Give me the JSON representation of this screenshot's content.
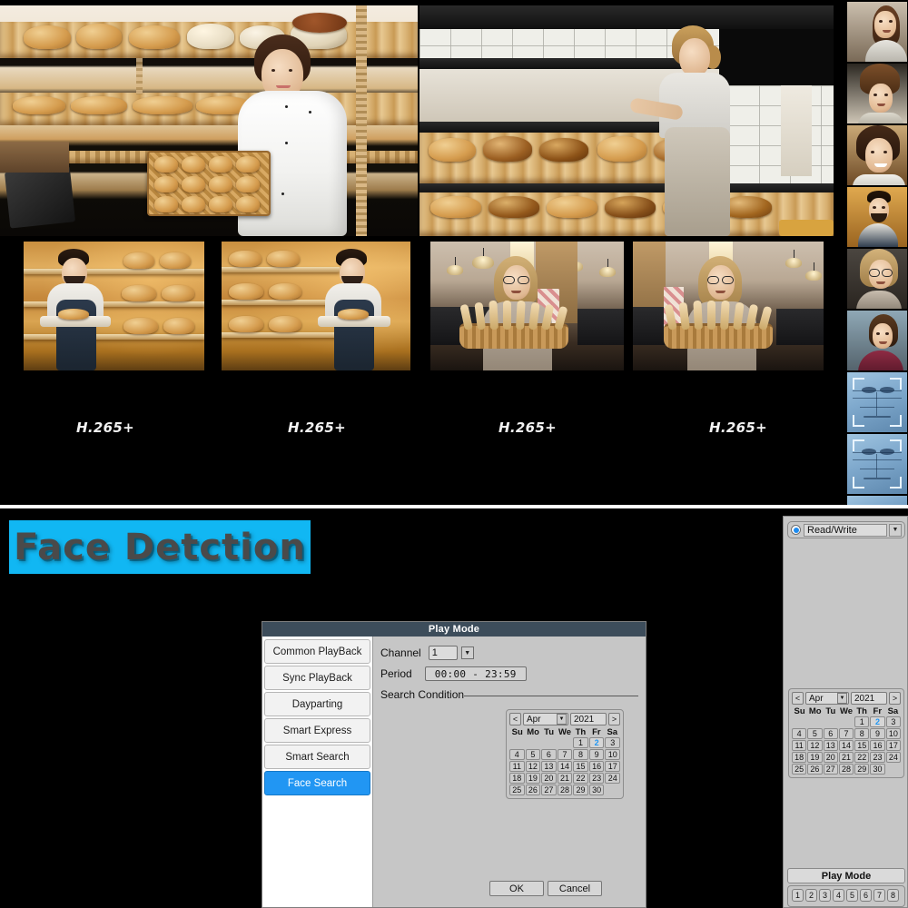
{
  "live_view": {
    "panels": [
      {
        "id": "panel-1",
        "scene": "bakery-woman-chef-coat-with-croissant-tray"
      },
      {
        "id": "panel-2",
        "scene": "bakery-woman-apron-stocking-bread-shelves"
      },
      {
        "id": "panel-3",
        "scene": "bakery-man-apron-holding-tray"
      },
      {
        "id": "panel-4",
        "scene": "bakery-man-apron-holding-tray"
      },
      {
        "id": "panel-5",
        "scene": "cafe-woman-glasses-with-baguette-basket"
      },
      {
        "id": "panel-6",
        "scene": "cafe-woman-glasses-with-baguette-basket"
      }
    ],
    "codec_labels": [
      "H.265+",
      "H.265+",
      "H.265+",
      "H.265+"
    ],
    "face_thumbnails": [
      {
        "label": "face-capture-1",
        "type": "photo"
      },
      {
        "label": "face-capture-2",
        "type": "photo"
      },
      {
        "label": "face-capture-3",
        "type": "photo"
      },
      {
        "label": "face-capture-4",
        "type": "photo"
      },
      {
        "label": "face-capture-5",
        "type": "photo"
      },
      {
        "label": "face-capture-6",
        "type": "photo"
      },
      {
        "label": "face-mesh-scan-1",
        "type": "biometric"
      },
      {
        "label": "face-mesh-scan-2",
        "type": "biometric"
      }
    ]
  },
  "banner": {
    "text": "Face Detction",
    "background": "#11b7f3",
    "text_color": "#4a4a4a"
  },
  "dialog": {
    "title": "Play Mode",
    "nav_items": [
      {
        "label": "Common PlayBack",
        "active": false
      },
      {
        "label": "Sync PlayBack",
        "active": false
      },
      {
        "label": "Dayparting",
        "active": false
      },
      {
        "label": "Smart Express",
        "active": false
      },
      {
        "label": "Smart Search",
        "active": false
      },
      {
        "label": "Face Search",
        "active": true
      }
    ],
    "channel_label": "Channel",
    "channel_value": "1",
    "period_label": "Period",
    "period_value": "00:00  -  23:59",
    "search_condition_label": "Search Condition",
    "ok_label": "OK",
    "cancel_label": "Cancel",
    "accent_color": "#2196f3",
    "titlebar_color": "#3d4d5b"
  },
  "calendar": {
    "prev_label": "<",
    "next_label": ">",
    "month": "Apr",
    "year": "2021",
    "dow": [
      "Su",
      "Mo",
      "Tu",
      "We",
      "Th",
      "Fr",
      "Sa"
    ],
    "leading_blanks": 4,
    "days": [
      1,
      2,
      3,
      4,
      5,
      6,
      7,
      8,
      9,
      10,
      11,
      12,
      13,
      14,
      15,
      16,
      17,
      18,
      19,
      20,
      21,
      22,
      23,
      24,
      25,
      26,
      27,
      28,
      29,
      30
    ],
    "selected_day": 2,
    "selected_color": "#2196f3"
  },
  "side_panel": {
    "read_write_label": "Read/Write",
    "play_mode_label": "Play Mode",
    "channels": [
      "1",
      "2",
      "3",
      "4",
      "5",
      "6",
      "7",
      "8"
    ]
  }
}
